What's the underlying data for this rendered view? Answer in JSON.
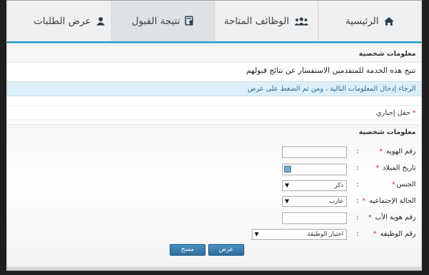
{
  "nav": {
    "items": [
      {
        "label": "الرئيسية",
        "icon": "home-icon"
      },
      {
        "label": "الوظائف المتاحة",
        "icon": "people-icon"
      },
      {
        "label": "نتيجة القبول",
        "icon": "certificate-icon"
      },
      {
        "label": "عرض الطلبات",
        "icon": "user-icon"
      }
    ],
    "accent": "#39a2c7"
  },
  "panel": {
    "title": "معلومات شخصية"
  },
  "intro": "تتيح هذه الخدمة للمتقدمين الاستفسار عن نتائج قبولهم",
  "notice": "الرجاء إدخال المعلومات التالية ، ومن ثم الضغط على عرض",
  "required_note": "حقل إجباري",
  "form": {
    "title": "معلومات شخصية",
    "id_label": "رقم الهويه",
    "dob_label": "تاريخ الميلاد",
    "gender_label": "الجنس",
    "gender_value": "ذكر",
    "marital_label": "الحالة الإجتماعيه",
    "marital_value": "عازب",
    "father_id_label": "رقم هوية الأب",
    "job_label": "رقم الوظيفه",
    "job_value": "اختيار الوظيفة",
    "colon": ":",
    "star": "*",
    "submit": "عرض",
    "clear": "مسح"
  }
}
